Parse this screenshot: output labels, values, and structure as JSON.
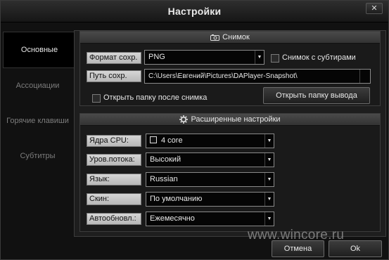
{
  "window": {
    "title": "Настройки"
  },
  "sidebar": {
    "items": [
      {
        "label": "Основные"
      },
      {
        "label": "Ассоциации"
      },
      {
        "label": "Горячие клавиши"
      },
      {
        "label": "Субтитры"
      }
    ]
  },
  "snapshot": {
    "header": "Снимок",
    "format_label": "Формат сохр.",
    "format_value": "PNG",
    "with_subtitles_label": "Снимок с субтирами",
    "path_label": "Путь сохр.",
    "path_value": "C:\\Users\\Евгений\\Pictures\\DAPlayer-Snapshot\\",
    "open_after_label": "Открыть папку после снимка",
    "open_folder_button": "Открыть папку вывода"
  },
  "advanced": {
    "header": "Расширенные настройки",
    "cpu_label": "Ядра CPU:",
    "cpu_value": "4 core",
    "priority_label": "Уров.потока:",
    "priority_value": "Высокий",
    "language_label": "Язык:",
    "language_value": "Russian",
    "skin_label": "Скин:",
    "skin_value": "По умолчанию",
    "autoupdate_label": "Автообновл.:",
    "autoupdate_value": "Ежемесячно"
  },
  "footer": {
    "cancel": "Отмена",
    "ok": "Ok"
  },
  "watermark": "www.wincore.ru"
}
